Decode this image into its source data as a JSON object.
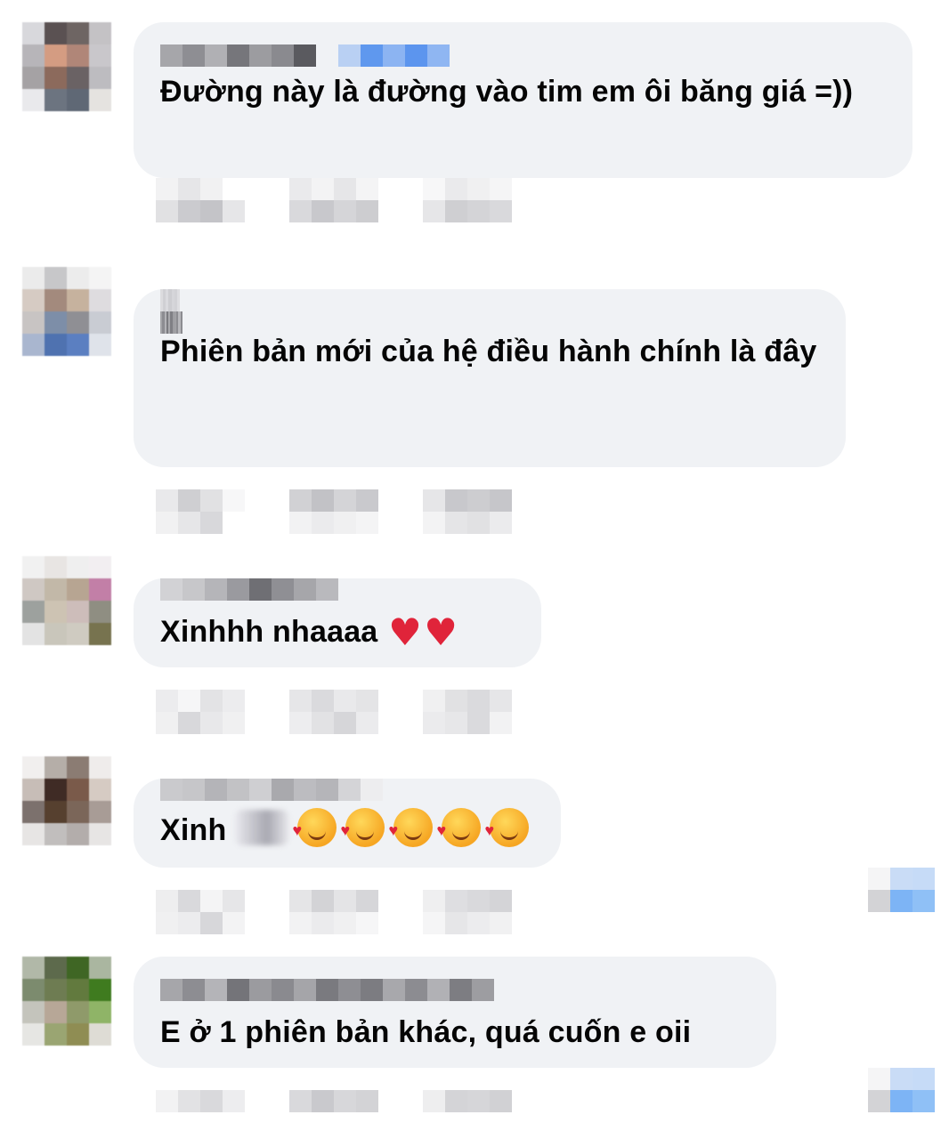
{
  "comments": [
    {
      "text": "Đường này là đường vào tim em ôi băng giá =))"
    },
    {
      "text": "Phiên bản mới của hệ điều hành chính là đây"
    },
    {
      "text": "Xinhhh nhaaaa",
      "reactions": [
        "heart-emoji",
        "heart-emoji"
      ]
    },
    {
      "text": "Xinh",
      "reactions": [
        "smiling-face-with-hearts-emoji",
        "smiling-face-with-hearts-emoji",
        "smiling-face-with-hearts-emoji",
        "smiling-face-with-hearts-emoji",
        "smiling-face-with-hearts-emoji"
      ]
    },
    {
      "text": "E ở 1 phiên bản khác, quá cuốn e oii"
    }
  ],
  "colors": {
    "bubble": "#f0f2f5",
    "text": "#050505",
    "heart": "#e0243a"
  }
}
